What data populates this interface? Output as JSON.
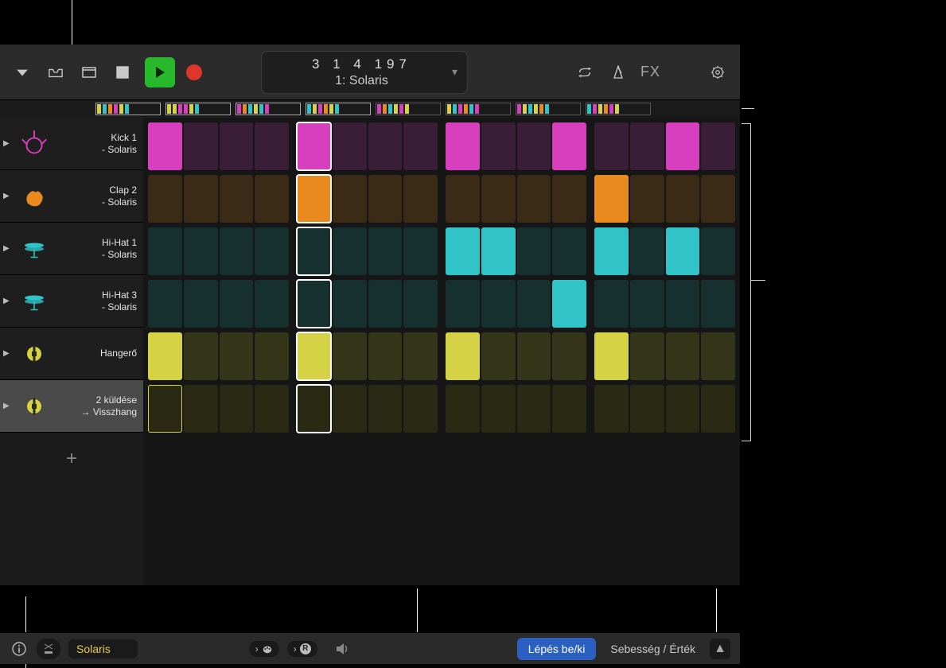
{
  "toolbar": {
    "lcd_line1": "3  1  4  197",
    "lcd_line2": "1: Solaris",
    "fx_label": "FX"
  },
  "ruler_colors": [
    [
      "#d6d245",
      "#30c4c9",
      "#e88a1e",
      "#d83fbf",
      "#d6d245",
      "#30c4c9"
    ],
    [
      "#d6d245",
      "#d6d245",
      "#d83fbf",
      "#d83fbf",
      "#d6d245",
      "#30c4c9"
    ],
    [
      "#d83fbf",
      "#e88a1e",
      "#30c4c9",
      "#d6d245",
      "#30c4c9",
      "#d83fbf"
    ],
    [
      "#30c4c9",
      "#d6d245",
      "#d83fbf",
      "#e88a1e",
      "#d6d245",
      "#30c4c9"
    ],
    [
      "#d83fbf",
      "#e88a1e",
      "#30c4c9",
      "#d6d245",
      "#d83fbf",
      "#d6d245"
    ],
    [
      "#d6d245",
      "#30c4c9",
      "#d83fbf",
      "#e88a1e",
      "#30c4c9",
      "#d83fbf"
    ],
    [
      "#d83fbf",
      "#d6d245",
      "#30c4c9",
      "#d6d245",
      "#e88a1e",
      "#30c4c9"
    ],
    [
      "#30c4c9",
      "#d83fbf",
      "#d6d245",
      "#e88a1e",
      "#d83fbf",
      "#d6d245"
    ]
  ],
  "tracks": [
    {
      "label": "Kick 1 - Solaris",
      "icon": "kick",
      "icon_color": "#d83fbf"
    },
    {
      "label": "Clap 2 - Solaris",
      "icon": "clap",
      "icon_color": "#e88a1e"
    },
    {
      "label": "Hi-Hat 1 - Solaris",
      "icon": "hihat",
      "icon_color": "#30c4c9"
    },
    {
      "label": "Hi-Hat 3 - Solaris",
      "icon": "hihat",
      "icon_color": "#30c4c9"
    },
    {
      "label": "Hangerő",
      "icon": "vol",
      "icon_color": "#d6d245"
    },
    {
      "label": "2 küldése → Visszhang",
      "icon": "send",
      "icon_color": "#d6d245"
    }
  ],
  "playhead_col": 4,
  "rows": [
    {
      "base": "#3a1d36",
      "accent": "#d83fbf",
      "on": [
        0,
        4,
        8,
        11,
        14
      ],
      "selected": [
        0
      ]
    },
    {
      "base": "#3b2a15",
      "accent": "#e88a1e",
      "on": [
        4,
        12
      ],
      "selected": []
    },
    {
      "base": "#15302f",
      "accent": "#30c4c9",
      "on": [
        8,
        9,
        12,
        14
      ],
      "selected": []
    },
    {
      "base": "#15302f",
      "accent": "#30c4c9",
      "on": [
        11
      ],
      "selected": []
    },
    {
      "base": "#35351a",
      "accent": "#d6d245",
      "on": [
        0,
        4,
        8,
        12
      ],
      "selected": []
    },
    {
      "base": "#2a2a14",
      "accent": "#d6d245",
      "on": [],
      "selected": [
        0
      ]
    }
  ],
  "footer": {
    "kit": "Solaris",
    "pill_r_label": "R",
    "step_toggle": "Lépés be/ki",
    "velocity_value": "Sebesség / Érték"
  }
}
